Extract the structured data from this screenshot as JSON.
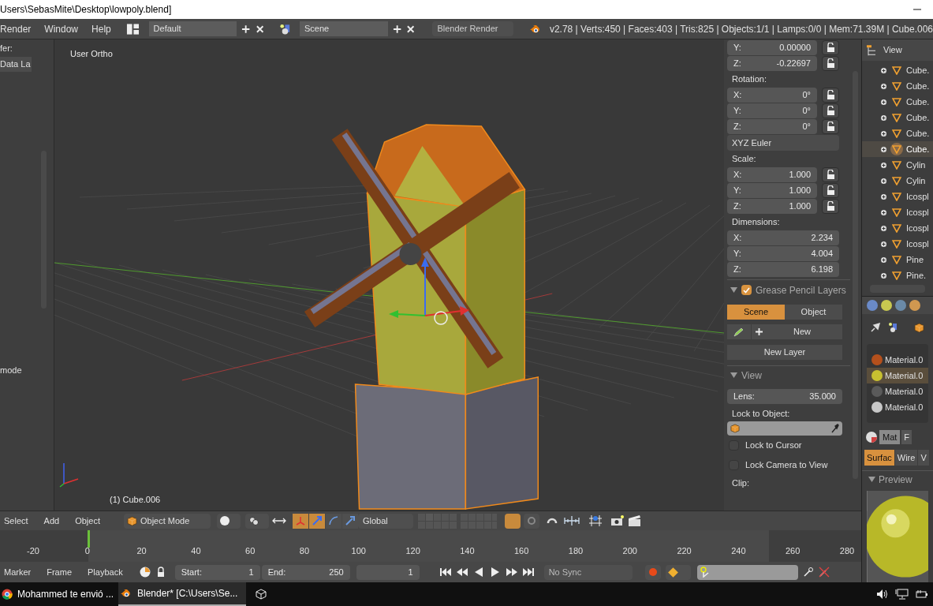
{
  "window": {
    "title": "Users\\SebasMite\\Desktop\\lowpoly.blend]"
  },
  "menu": [
    "Render",
    "Window",
    "Help"
  ],
  "screen_layout": "Default",
  "scene": "Scene",
  "render_engine": "Blender Render",
  "info": "v2.78 | Verts:450 | Faces:403 | Tris:825 | Objects:1/1 | Lamps:0/0 | Mem:71.39M | Cube.006",
  "toolshelf": {
    "label": "fer:",
    "button": "Data La",
    "footer": "mode"
  },
  "viewport": {
    "view_name": "User Ortho",
    "object_name": "(1) Cube.006"
  },
  "n_panel": {
    "groups": [
      {
        "rows": [
          {
            "axis": "Y:",
            "value": "0.00000"
          },
          {
            "axis": "Z:",
            "value": "-0.22697"
          }
        ],
        "locks": true
      },
      {
        "title": "Rotation:",
        "rows": [
          {
            "axis": "X:",
            "value": "0°"
          },
          {
            "axis": "Y:",
            "value": "0°"
          },
          {
            "axis": "Z:",
            "value": "0°"
          }
        ],
        "locks": true,
        "mode": "XYZ Euler"
      },
      {
        "title": "Scale:",
        "rows": [
          {
            "axis": "X:",
            "value": "1.000"
          },
          {
            "axis": "Y:",
            "value": "1.000"
          },
          {
            "axis": "Z:",
            "value": "1.000"
          }
        ],
        "locks": true
      },
      {
        "title": "Dimensions:",
        "rows": [
          {
            "axis": "X:",
            "value": "2.234"
          },
          {
            "axis": "Y:",
            "value": "4.004"
          },
          {
            "axis": "Z:",
            "value": "6.198"
          }
        ],
        "locks": false
      }
    ],
    "grease_pencil": {
      "title": "Grease Pencil Layers",
      "enabled": true,
      "tabs": [
        {
          "label": "Scene",
          "selected": true
        },
        {
          "label": "Object",
          "selected": false
        }
      ],
      "new": "New",
      "new_layer": "New Layer"
    },
    "view": {
      "title": "View",
      "lens_label": "Lens:",
      "lens": "35.000",
      "lock_label": "Lock to Object:",
      "checks": [
        {
          "label": "Lock to Cursor",
          "checked": false
        },
        {
          "label": "Lock Camera to View",
          "checked": false
        }
      ],
      "clip": "Clip:"
    }
  },
  "outliner": {
    "menu": "View",
    "items": [
      {
        "name": "Cube.",
        "selected": false
      },
      {
        "name": "Cube.",
        "selected": false
      },
      {
        "name": "Cube.",
        "selected": false
      },
      {
        "name": "Cube.",
        "selected": false
      },
      {
        "name": "Cube.",
        "selected": false
      },
      {
        "name": "Cube.",
        "selected": true
      },
      {
        "name": "Cylin",
        "selected": false
      },
      {
        "name": "Cylin",
        "selected": false
      },
      {
        "name": "Icospl",
        "selected": false
      },
      {
        "name": "Icospl",
        "selected": false
      },
      {
        "name": "Icospl",
        "selected": false
      },
      {
        "name": "Icospl",
        "selected": false
      },
      {
        "name": "Pine",
        "selected": false
      },
      {
        "name": "Pine.",
        "selected": false
      }
    ]
  },
  "properties": {
    "materials": [
      {
        "name": "Material.0",
        "color": "#b4501c",
        "selected": false
      },
      {
        "name": "Material.0",
        "color": "#c8c030",
        "selected": true
      },
      {
        "name": "Material.0",
        "color": "#5a5a5a",
        "selected": false
      },
      {
        "name": "Material.0",
        "color": "#c8c8c8",
        "selected": false
      }
    ],
    "material_field": "Mat",
    "fake_user": "F",
    "tabs": [
      {
        "label": "Surfac",
        "selected": true
      },
      {
        "label": "Wire",
        "selected": false
      },
      {
        "label": "V",
        "selected": false
      }
    ],
    "preview": "Preview"
  },
  "view_header": {
    "menus": [
      "Select",
      "Add",
      "Object"
    ],
    "mode": "Object Mode",
    "orientation": "Global"
  },
  "timeline": {
    "ticks": [
      "-20",
      "0",
      "20",
      "40",
      "60",
      "80",
      "100",
      "120",
      "140",
      "160",
      "180",
      "200",
      "220",
      "240",
      "260",
      "280"
    ],
    "menus": [
      "Marker",
      "Frame",
      "Playback"
    ],
    "start_label": "Start:",
    "start": "1",
    "end_label": "End:",
    "end": "250",
    "current": "1",
    "sync": "No Sync"
  },
  "taskbar": [
    {
      "label": "Mohammed te envió ...",
      "kind": "chrome",
      "selected": false
    },
    {
      "label": "Blender* [C:\\Users\\Se...",
      "kind": "blender",
      "selected": true
    }
  ]
}
